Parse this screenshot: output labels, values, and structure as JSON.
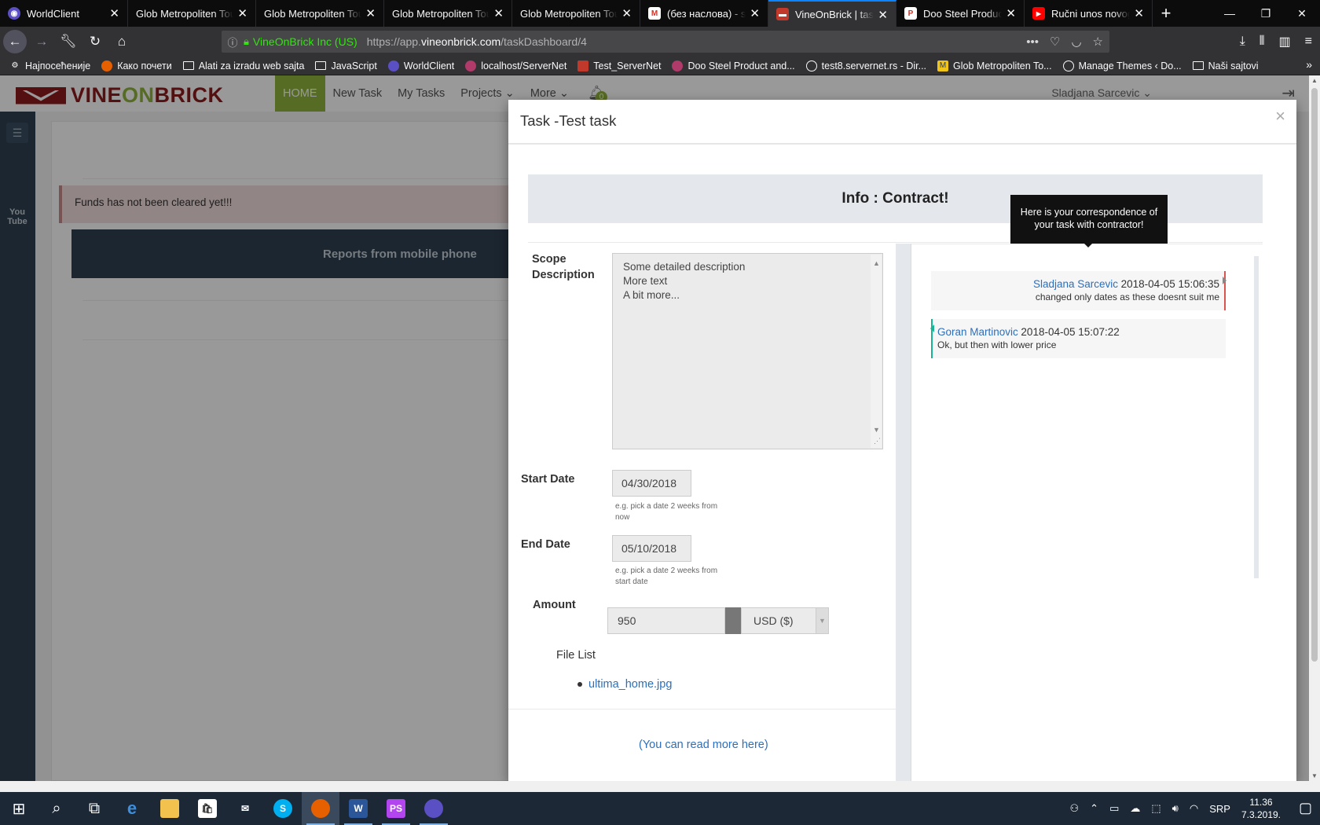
{
  "browser": {
    "tabs": [
      {
        "label": "WorldClient",
        "icon": "worldclient-icon",
        "color": "#6a5acd",
        "active": false
      },
      {
        "label": "Glob Metropoliten Tours",
        "icon": "",
        "color": "",
        "active": false
      },
      {
        "label": "Glob Metropoliten Tours",
        "icon": "",
        "color": "",
        "active": false
      },
      {
        "label": "Glob Metropoliten Tours",
        "icon": "",
        "color": "",
        "active": false
      },
      {
        "label": "Glob Metropoliten Tours",
        "icon": "",
        "color": "",
        "active": false
      },
      {
        "label": "(без наслова) - sladjana",
        "icon": "gmail-icon",
        "color": "#d93025",
        "active": false
      },
      {
        "label": "VineOnBrick | taskDashboard",
        "icon": "vineonbrick-icon",
        "color": "#c0392b",
        "active": true
      },
      {
        "label": "Doo Steel Product and",
        "icon": "steel-icon",
        "color": "#c0392b",
        "active": false
      },
      {
        "label": "Ručni unos novog",
        "icon": "youtube-icon",
        "color": "#ff0000",
        "active": false
      }
    ],
    "url": {
      "org": "VineOnBrick Inc (US)",
      "prefix": "https://app.",
      "domain": "vineonbrick.com",
      "path": "/taskDashboard/4"
    },
    "bookmarks": [
      {
        "label": "Најпосећеније",
        "icon": "gear-icon"
      },
      {
        "label": "Како почети",
        "icon": "firefox-icon"
      },
      {
        "label": "Alati za izradu web sajta",
        "icon": "folder-icon"
      },
      {
        "label": "JavaScript",
        "icon": "folder-icon"
      },
      {
        "label": "WorldClient",
        "icon": "worldclient-icon"
      },
      {
        "label": "localhost/ServerNet",
        "icon": "servernet-icon"
      },
      {
        "label": "Test_ServerNet",
        "icon": "servernet-icon"
      },
      {
        "label": "Doo Steel Product and...",
        "icon": "steel-icon"
      },
      {
        "label": "test8.servernet.rs - Dir...",
        "icon": "globe-icon"
      },
      {
        "label": "Glob Metropoliten To...",
        "icon": "m-icon"
      },
      {
        "label": "Manage Themes ‹ Do...",
        "icon": "globe-icon"
      },
      {
        "label": "Naši sajtovi",
        "icon": "folder-icon"
      }
    ]
  },
  "app": {
    "logo_left": "VINE",
    "logo_mid": "ON",
    "logo_right": "BRICK",
    "nav": [
      "HOME",
      "New Task",
      "My Tasks",
      "Projects ⌄",
      "More ⌄"
    ],
    "notifications": "0",
    "user": "Sladjana Sarcevic ⌄",
    "alert": "Funds has not been cleared yet!!!",
    "reports": "Reports from mobile phone"
  },
  "modal": {
    "title": "Task -Test task",
    "close": "×",
    "info": "Info : Contract!",
    "tooltip": "Here is your correspondence of your task with contractor!",
    "scope_label": "Scope Description",
    "scope_lines": [
      "Some detailed description",
      "More text",
      "A bit more..."
    ],
    "start_label": "Start Date",
    "start_value": "04/30/2018",
    "start_hint": "e.g. pick a date 2 weeks from now",
    "end_label": "End Date",
    "end_value": "05/10/2018",
    "end_hint": "e.g. pick a date 2 weeks from start date",
    "amount_label": "Amount",
    "amount_value": "950",
    "currency": "USD ($)",
    "file_list_label": "File List",
    "file": "ultima_home.jpg",
    "read_more": "(You can read more here)",
    "messages": [
      {
        "author": "Sladjana Sarcevic",
        "time": "2018-04-05 15:06:35",
        "text": "changed only dates as these doesnt suit me",
        "side": "right"
      },
      {
        "author": "Goran Martinovic",
        "time": "2018-04-05 15:07:22",
        "text": "Ok, but then with lower price",
        "side": "left"
      }
    ]
  },
  "taskbar": {
    "lang": "SRP",
    "time": "11.36",
    "date": "7.3.2019."
  },
  "colors": {
    "brand_green": "#8fb33b",
    "brand_red": "#8c1b1b",
    "sidebar": "#2f4050"
  }
}
